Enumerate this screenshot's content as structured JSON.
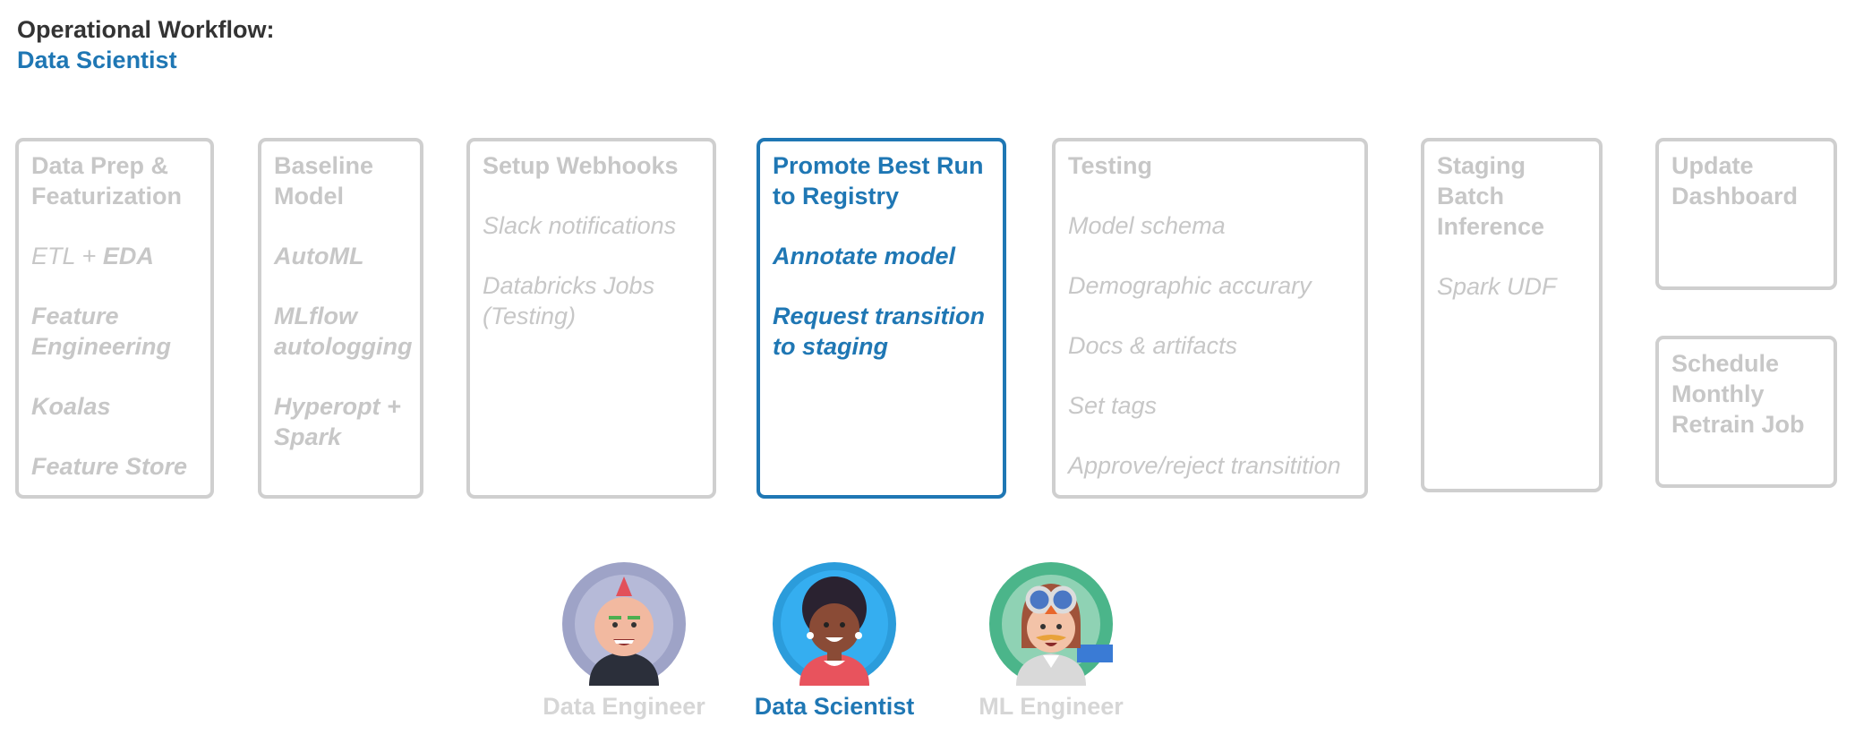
{
  "title": {
    "line1": "Operational Workflow:",
    "line2": "Data Scientist"
  },
  "colors": {
    "accent": "#1f77b4",
    "inactive": "#c7c7c7",
    "heading": "#333333"
  },
  "steps": [
    {
      "title": "Data Prep & Featurization",
      "items": [
        "ETL + ",
        "EDA",
        "Feature Engineering",
        "Koalas",
        "Feature Store"
      ]
    },
    {
      "title": "Baseline Model",
      "items": [
        "AutoML",
        "MLflow autologging",
        "Hyperopt + Spark"
      ]
    },
    {
      "title": "Setup Webhooks",
      "items": [
        "Slack notifications",
        "Databricks Jobs (Testing)"
      ]
    },
    {
      "title": "Promote Best Run to Registry",
      "items": [
        "Annotate model",
        "Request transition to staging"
      ]
    },
    {
      "title": "Testing",
      "items": [
        "Model schema",
        "Demographic accurary",
        "Docs & artifacts",
        "Set tags",
        "Approve/reject transitition"
      ]
    },
    {
      "title": "Staging Batch Inference",
      "items": [
        "Spark UDF"
      ]
    },
    {
      "title": "Update Dashboard",
      "items": []
    },
    {
      "title": "Schedule Monthly Retrain Job",
      "items": []
    }
  ],
  "personas": [
    {
      "label": "Data Engineer",
      "icon": "data-engineer-avatar"
    },
    {
      "label": "Data Scientist",
      "icon": "data-scientist-avatar"
    },
    {
      "label": "ML Engineer",
      "icon": "ml-engineer-avatar"
    }
  ]
}
